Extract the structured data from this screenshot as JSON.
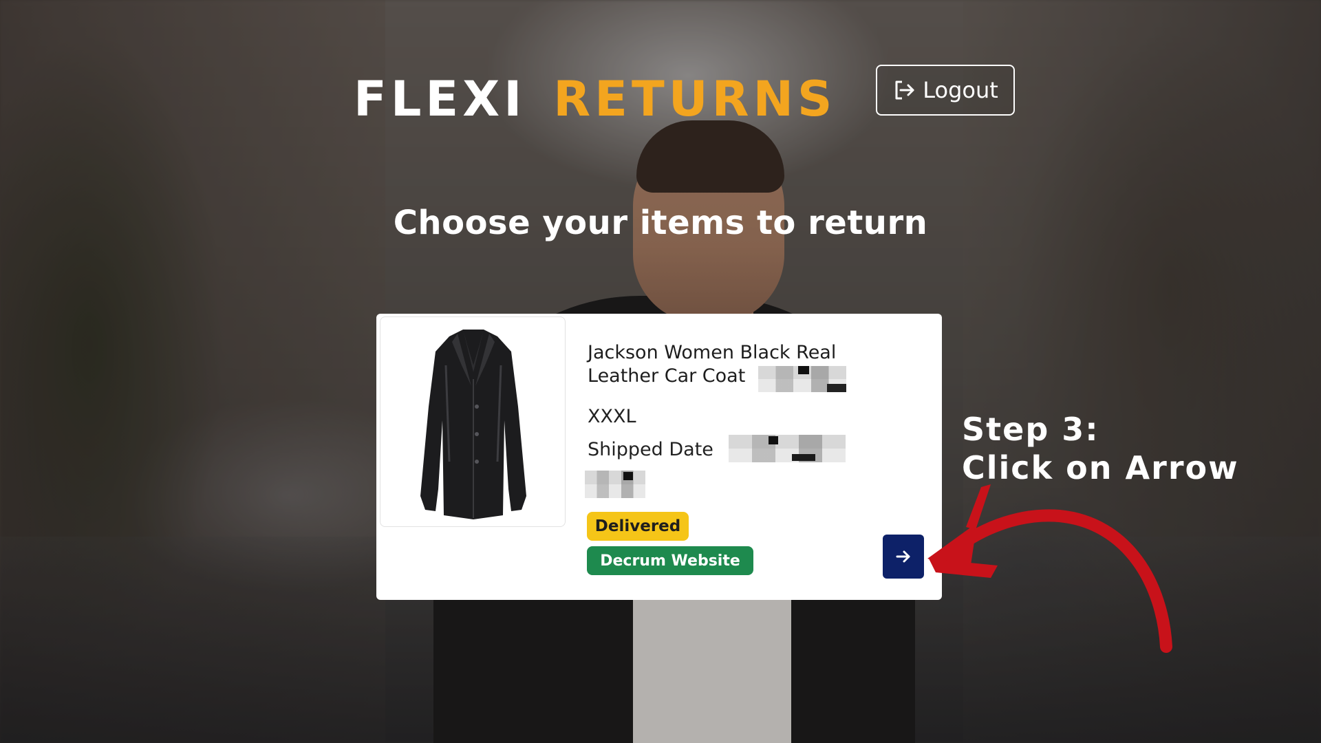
{
  "brand": {
    "logo_part1": "FLEXI",
    "logo_part2": "RETURNS",
    "accent_color": "#f3a51f"
  },
  "header": {
    "logout_label": "Logout",
    "logout_icon": "logout-icon"
  },
  "main": {
    "heading": "Choose your items to return"
  },
  "item": {
    "title": "Jackson Women Black Real Leather Car Coat",
    "size": "XXXL",
    "shipped_date_label": "Shipped Date",
    "status_badge": "Delivered",
    "source_badge": "Decrum Website",
    "status_color": "#f5c518",
    "source_color": "#1e8a4e",
    "next_button_icon": "arrow-right-icon",
    "next_button_color": "#0d2168"
  },
  "annotation": {
    "step_line1": "Step 3:",
    "step_line2": "Click on Arrow",
    "arrow_color": "#c8121a"
  }
}
